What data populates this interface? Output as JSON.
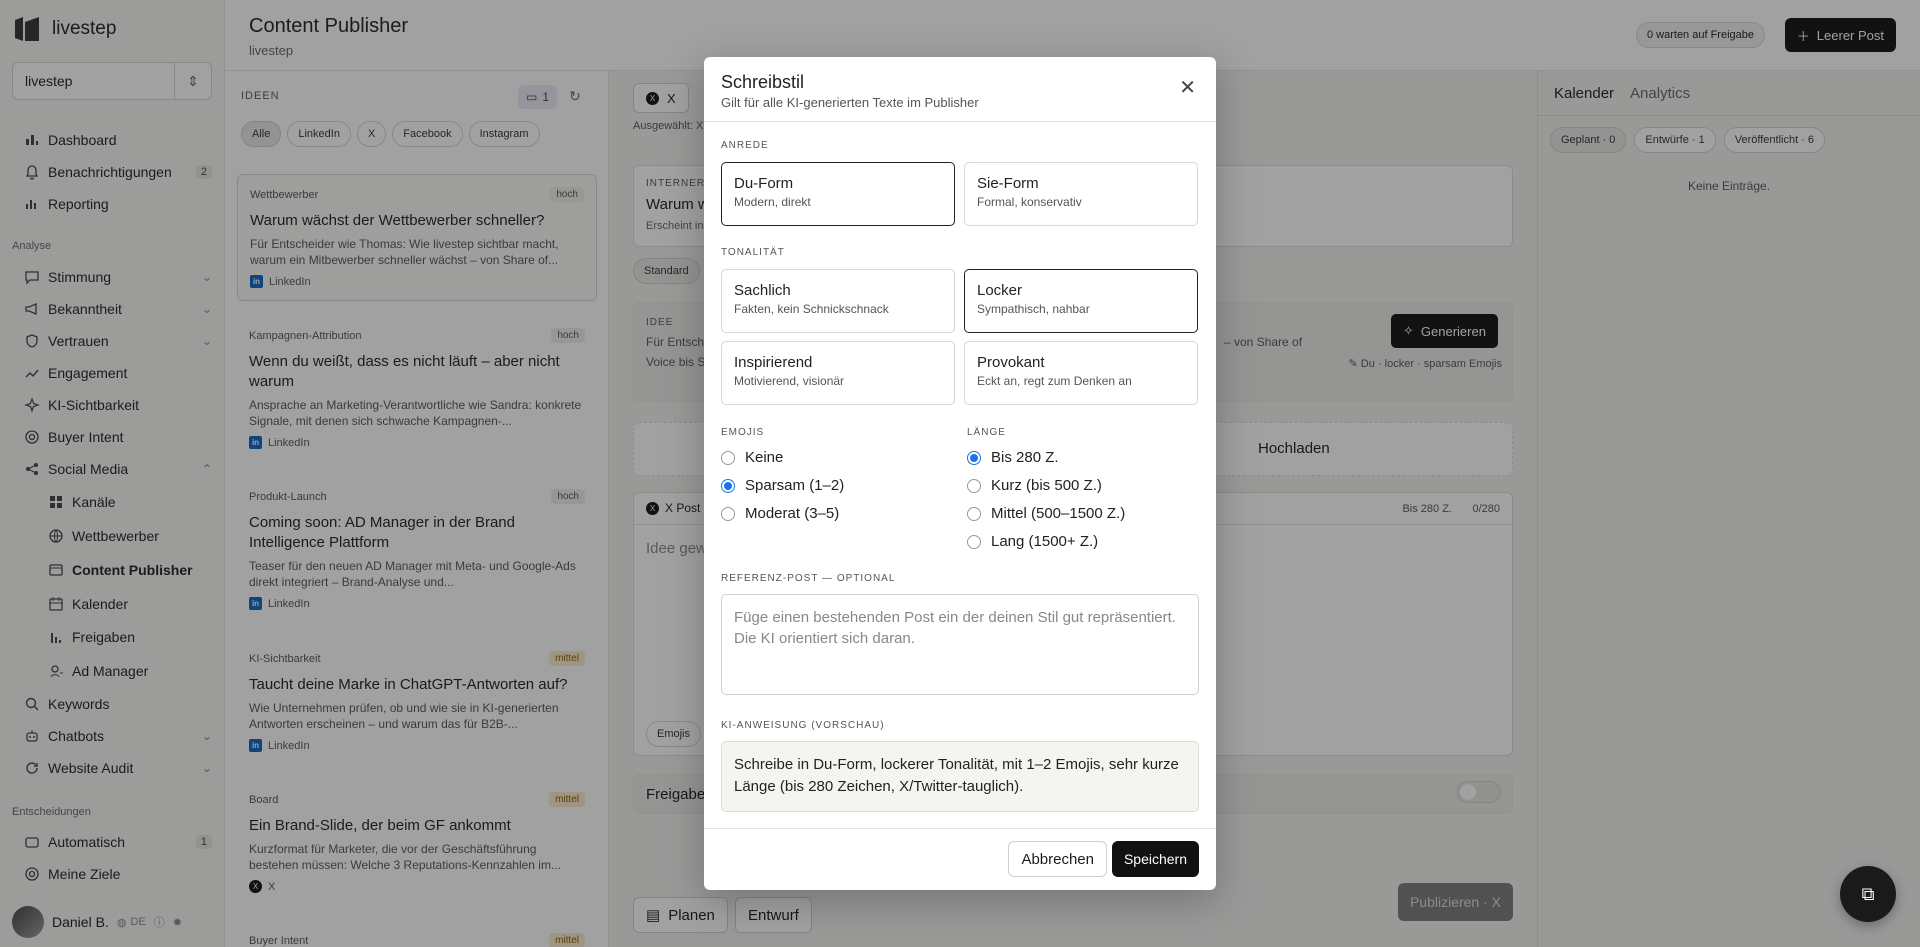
{
  "app": {
    "name": "livestep",
    "workspace": "livestep"
  },
  "sidebar": {
    "items": [
      {
        "label": "Dashboard",
        "icon": "home-icon"
      },
      {
        "label": "Benachrichtigungen",
        "icon": "bell-icon",
        "count": "2"
      },
      {
        "label": "Reporting",
        "icon": "chart-icon"
      }
    ],
    "section_analyse": "Analyse",
    "analyse": [
      {
        "label": "Stimmung"
      },
      {
        "label": "Bekanntheit"
      },
      {
        "label": "Vertrauen"
      },
      {
        "label": "Engagement"
      },
      {
        "label": "KI-Sichtbarkeit"
      },
      {
        "label": "Buyer Intent"
      },
      {
        "label": "Social Media"
      }
    ],
    "social": [
      {
        "label": "Kanäle"
      },
      {
        "label": "Wettbewerber"
      },
      {
        "label": "Content Publisher"
      },
      {
        "label": "Kalender"
      },
      {
        "label": "Freigaben"
      },
      {
        "label": "Ad Manager"
      }
    ],
    "more": [
      {
        "label": "Keywords"
      },
      {
        "label": "Chatbots"
      },
      {
        "label": "Website Audit"
      }
    ],
    "section_entscheidungen": "Entscheidungen",
    "decisions": [
      {
        "label": "Automatisch",
        "count": "1"
      },
      {
        "label": "Meine Ziele"
      }
    ],
    "user": {
      "name": "Daniel B.",
      "lang": "DE"
    }
  },
  "header": {
    "title": "Content Publisher",
    "subtitle": "livestep",
    "pending": "0 warten auf Freigabe",
    "new_post": "Leerer Post"
  },
  "ideas": {
    "heading": "IDEEN",
    "badge": "1",
    "filters": [
      "Alle",
      "LinkedIn",
      "X",
      "Facebook",
      "Instagram"
    ],
    "cards": [
      {
        "tag": "Wettbewerber",
        "prio": "hoch",
        "title": "Warum wächst der Wettbewerber schneller?",
        "desc": "Für Entscheider wie Thomas: Wie livestep sichtbar macht, warum ein Mitbewerber schneller wächst – von Share of...",
        "channel": "LinkedIn"
      },
      {
        "tag": "Kampagnen-Attribution",
        "prio": "hoch",
        "title": "Wenn du weißt, dass es nicht läuft – aber nicht warum",
        "desc": "Ansprache an Marketing-Verantwortliche wie Sandra: konkrete Signale, mit denen sich schwache Kampagnen-...",
        "channel": "LinkedIn"
      },
      {
        "tag": "Produkt-Launch",
        "prio": "hoch",
        "title": "Coming soon: AD Manager in der Brand Intelligence Plattform",
        "desc": "Teaser für den neuen AD Manager mit Meta- und Google-Ads direkt integriert – Brand-Analyse und...",
        "channel": "LinkedIn"
      },
      {
        "tag": "KI-Sichtbarkeit",
        "prio": "mittel",
        "title": "Taucht deine Marke in ChatGPT-Antworten auf?",
        "desc": "Wie Unternehmen prüfen, ob und wie sie in KI-generierten Antworten erscheinen – und warum das für B2B-...",
        "channel": "LinkedIn"
      },
      {
        "tag": "Board",
        "prio": "mittel",
        "title": "Ein Brand-Slide, der beim GF ankommt",
        "desc": "Kurzformat für Marketer, die vor der Geschäftsführung bestehen müssen: Welche 3 Reputations-Kennzahlen im...",
        "channel": "X"
      },
      {
        "tag": "Buyer Intent",
        "prio": "mittel"
      }
    ]
  },
  "editor": {
    "platform": "X",
    "selected": "Ausgewählt: X",
    "internal": "INTERNER",
    "internal_title": "Warum w",
    "internal_sub": "Erscheint in",
    "standard": "Standard",
    "idea_label": "IDEE",
    "idea_text": "Für Entsch",
    "idea_text2": "Voice bis S",
    "idea_text_right": "– von Share of",
    "style_hint": "Du · locker · sparsam Emojis",
    "generate": "Generieren",
    "upload": "Hochladen",
    "post_label": "X  Post",
    "limit": "Bis 280 Z.",
    "counter": "0/280",
    "placeholder": "Idee gew",
    "emojis": "Emojis",
    "release": "Freigabe",
    "plan": "Planen",
    "draft": "Entwurf",
    "publish": "Publizieren · X"
  },
  "right": {
    "tabs": [
      "Kalender",
      "Analytics"
    ],
    "chips": [
      "Geplant · 0",
      "Entwürfe · 1",
      "Veröffentlicht · 6"
    ],
    "empty": "Keine Einträge."
  },
  "modal": {
    "title": "Schreibstil",
    "subtitle": "Gilt für alle KI-generierten Texte im Publisher",
    "anrede_label": "ANREDE",
    "anrede": [
      {
        "h": "Du-Form",
        "d": "Modern, direkt",
        "selected": true
      },
      {
        "h": "Sie-Form",
        "d": "Formal, konservativ",
        "selected": false
      }
    ],
    "ton_label": "TONALITÄT",
    "ton": [
      {
        "h": "Sachlich",
        "d": "Fakten, kein Schnickschnack",
        "selected": false
      },
      {
        "h": "Locker",
        "d": "Sympathisch, nahbar",
        "selected": true
      },
      {
        "h": "Inspirierend",
        "d": "Motivierend, visionär",
        "selected": false
      },
      {
        "h": "Provokant",
        "d": "Eckt an, regt zum Denken an",
        "selected": false
      }
    ],
    "emoji_label": "EMOJIS",
    "emojis": [
      {
        "l": "Keine",
        "selected": false
      },
      {
        "l": "Sparsam (1–2)",
        "selected": true
      },
      {
        "l": "Moderat (3–5)",
        "selected": false
      }
    ],
    "length_label": "LÄNGE",
    "lengths": [
      {
        "l": "Bis 280 Z.",
        "selected": true
      },
      {
        "l": "Kurz (bis 500 Z.)",
        "selected": false
      },
      {
        "l": "Mittel (500–1500 Z.)",
        "selected": false
      },
      {
        "l": "Lang (1500+ Z.)",
        "selected": false
      }
    ],
    "ref_label": "REFERENZ-POST — OPTIONAL",
    "ref_placeholder": "Füge einen bestehenden Post ein der deinen Stil gut repräsentiert. Die KI orientiert sich daran.",
    "preview_label": "KI-ANWEISUNG (VORSCHAU)",
    "preview": "Schreibe in Du-Form, lockerer Tonalität, mit 1–2 Emojis, sehr kurze Länge (bis 280 Zeichen, X/Twitter-tauglich).",
    "cancel": "Abbrechen",
    "save": "Speichern"
  },
  "colors": {
    "accent": "#111111",
    "radio": "#1a73e8",
    "prio_mid": "#fbeccd"
  }
}
